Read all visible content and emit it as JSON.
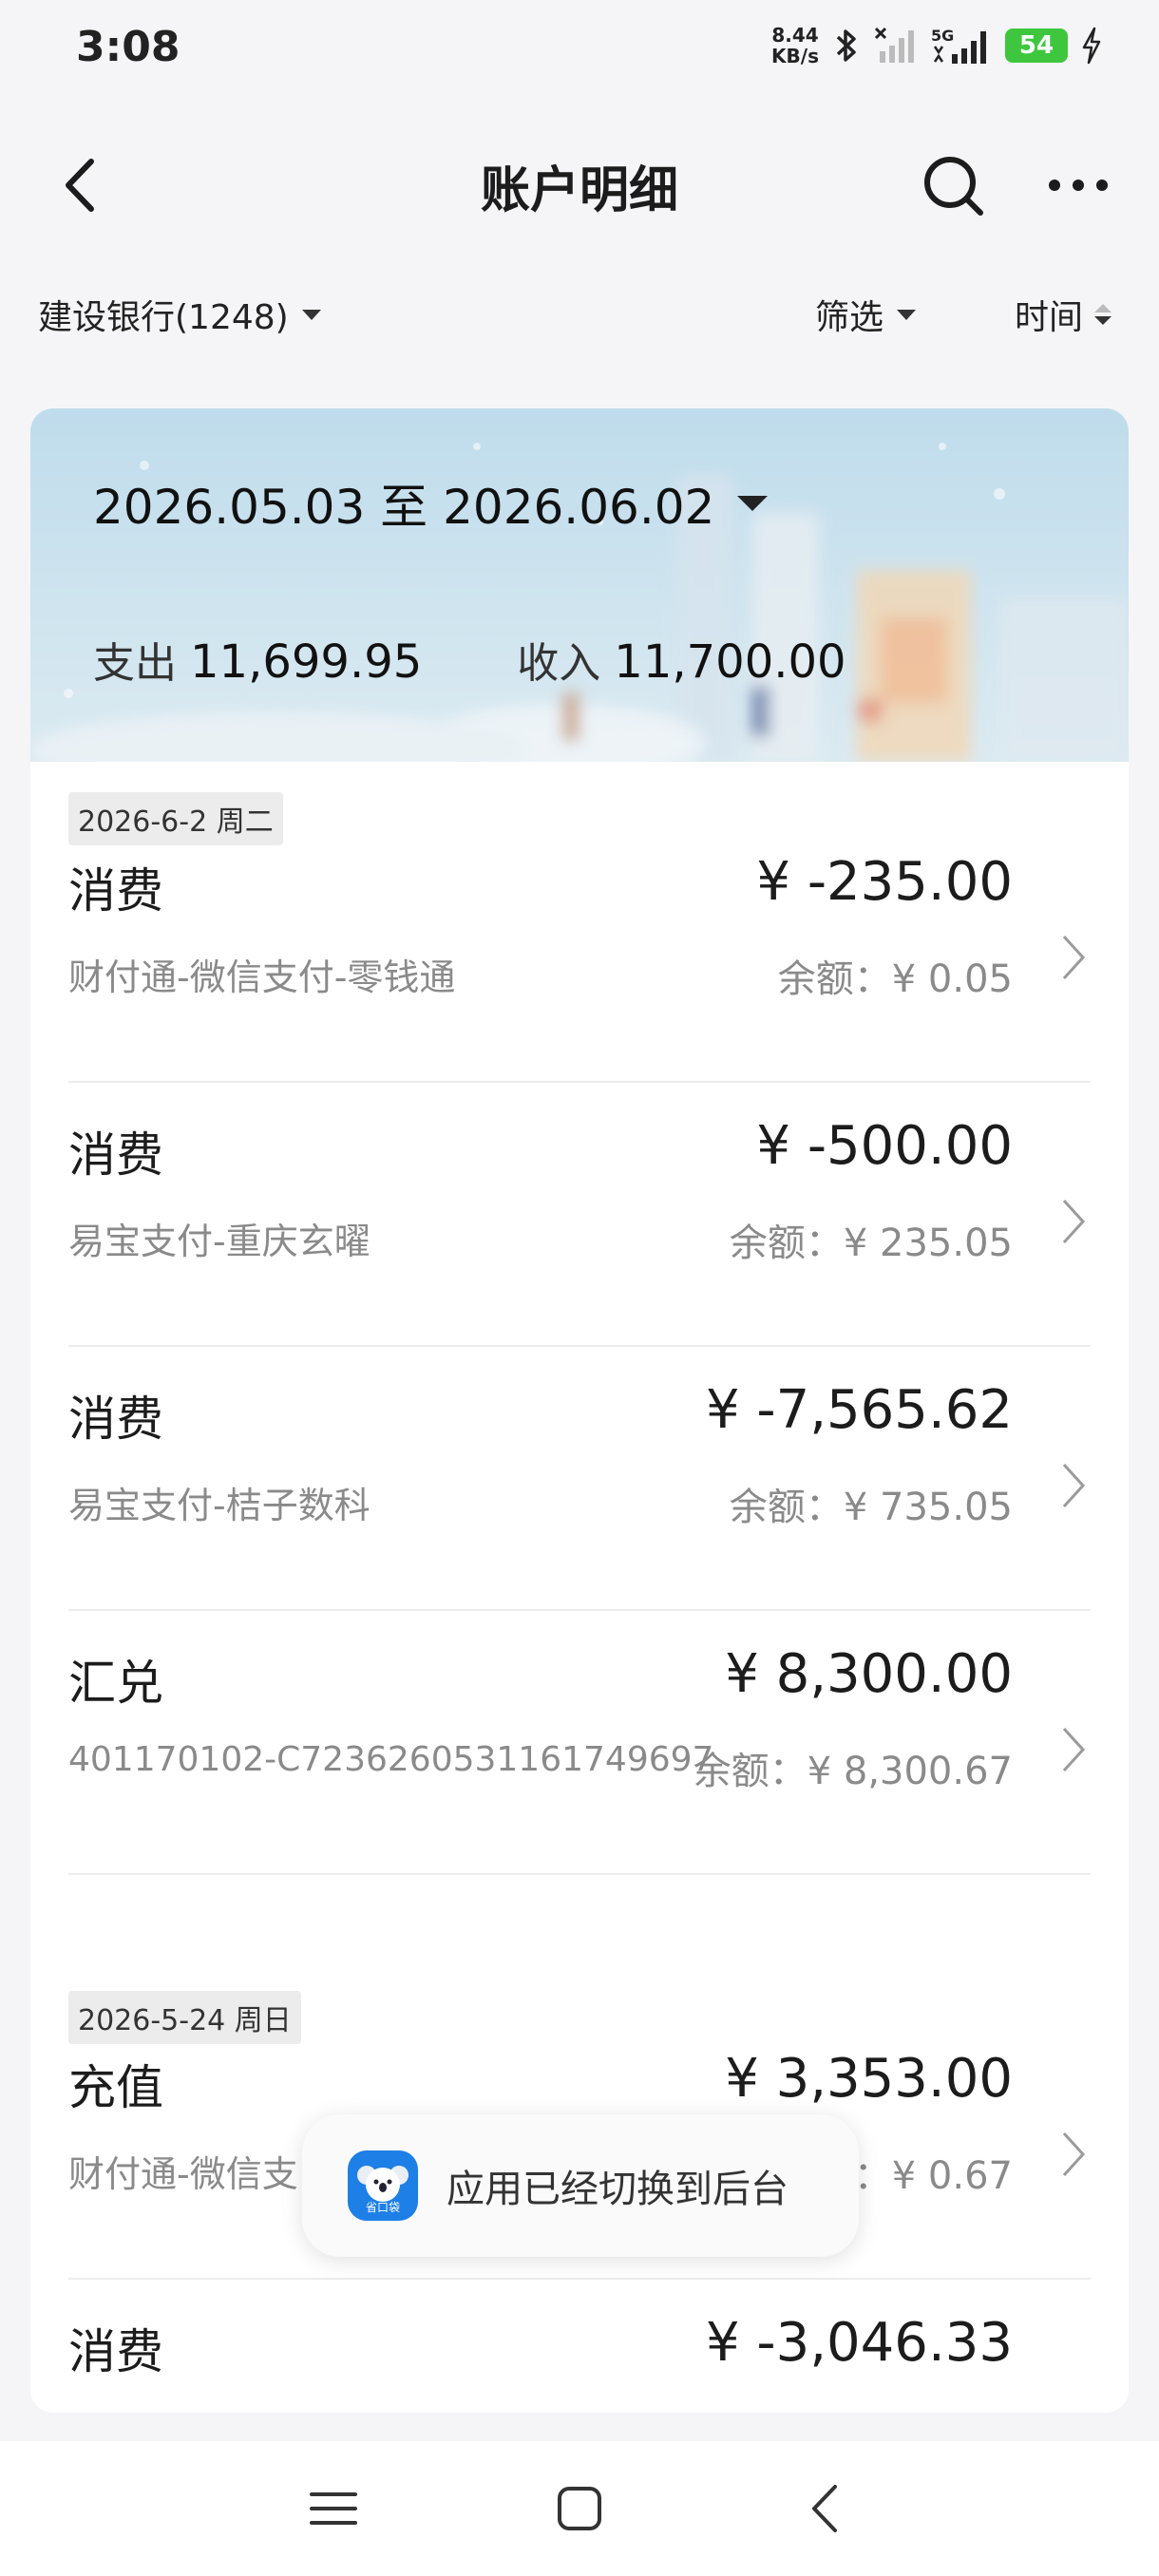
{
  "status_bar": {
    "time": "3:08",
    "net_speed_value": "8.44",
    "net_speed_unit": "KB/s",
    "network_type": "5G",
    "battery": "54",
    "battery_color": "#3ec73e"
  },
  "header": {
    "title": "账户明细"
  },
  "filters": {
    "account": "建设银行(1248)",
    "filter_label": "筛选",
    "sort_label": "时间"
  },
  "summary": {
    "date_range": "2026.05.03 至 2026.06.02",
    "expense_label": "支出",
    "expense_value": "11,699.95",
    "income_label": "收入",
    "income_value": "11,700.00"
  },
  "groups": [
    {
      "date": "2026-6-2 周二",
      "transactions": [
        {
          "type": "消费",
          "amount": "¥ -235.00",
          "description": "财付通-微信支付-零钱通",
          "balance": "余额：¥ 0.05"
        },
        {
          "type": "消费",
          "amount": "¥ -500.00",
          "description": "易宝支付-重庆玄曜",
          "balance": "余额：¥ 235.05"
        },
        {
          "type": "消费",
          "amount": "¥ -7,565.62",
          "description": "易宝支付-桔子数科",
          "balance": "余额：¥ 735.05"
        },
        {
          "type": "汇兑",
          "amount": "¥ 8,300.00",
          "description": "401170102-C7236260531161749697",
          "balance": "余额：¥ 8,300.67"
        }
      ]
    },
    {
      "date": "2026-5-24 周日",
      "transactions": [
        {
          "type": "充值",
          "amount": "¥ 3,353.00",
          "description": "财付通-微信支",
          "balance": "余额：¥ 0.67"
        },
        {
          "type": "消费",
          "amount": "¥ -3,046.33"
        }
      ]
    }
  ],
  "toast": {
    "app_icon_text": "省口袋",
    "message": "应用已经切换到后台"
  }
}
